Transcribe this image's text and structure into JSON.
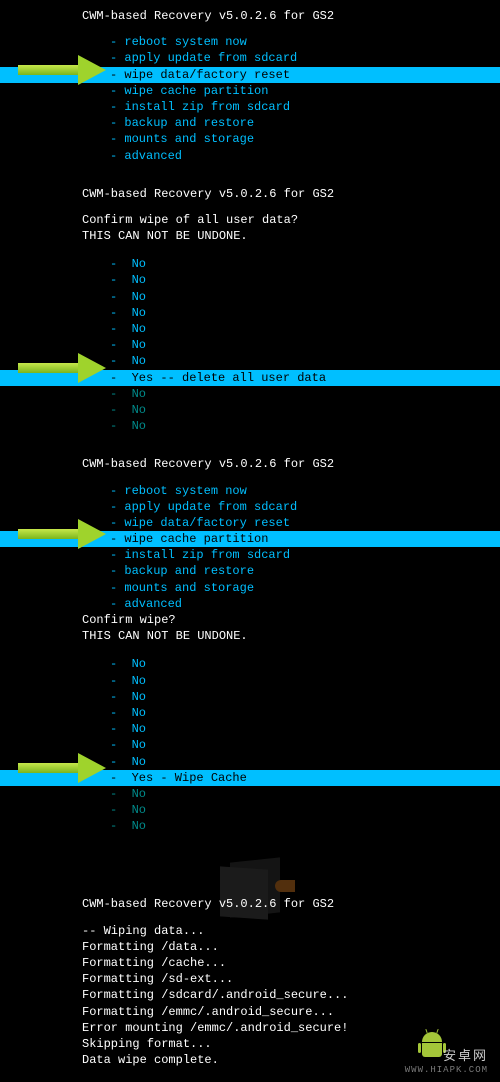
{
  "header": "CWM-based Recovery v5.0.2.6 for GS2",
  "panel1": {
    "items": [
      "- reboot system now",
      "- apply update from sdcard",
      "- wipe data/factory reset",
      "- wipe cache partition",
      "- install zip from sdcard",
      "- backup and restore",
      "- mounts and storage",
      "- advanced"
    ],
    "selected_index": 2
  },
  "panel2": {
    "prompt1": "Confirm wipe of all user data?",
    "prompt2": "  THIS CAN NOT BE UNDONE.",
    "items": [
      "-  No",
      "-  No",
      "-  No",
      "-  No",
      "-  No",
      "-  No",
      "-  No",
      "-  Yes -- delete all user data",
      "-  No",
      "-  No",
      "-  No"
    ],
    "selected_index": 7
  },
  "panel3": {
    "items": [
      "- reboot system now",
      "- apply update from sdcard",
      "- wipe data/factory reset",
      "- wipe cache partition",
      "- install zip from sdcard",
      "- backup and restore",
      "- mounts and storage",
      "- advanced"
    ],
    "selected_index": 3,
    "prompt1": "Confirm wipe?",
    "prompt2": "  THIS CAN NOT BE UNDONE.",
    "confirm_items": [
      "-  No",
      "-  No",
      "-  No",
      "-  No",
      "-  No",
      "-  No",
      "-  No",
      "-  Yes - Wipe Cache",
      "-  No",
      "-  No",
      "-  No"
    ],
    "confirm_selected_index": 7
  },
  "panel4": {
    "log": [
      "-- Wiping data...",
      "Formatting /data...",
      "Formatting /cache...",
      "Formatting /sd-ext...",
      "Formatting /sdcard/.android_secure...",
      "Formatting /emmc/.android_secure...",
      "Error mounting /emmc/.android_secure!",
      "Skipping format...",
      "Data wipe complete."
    ]
  },
  "watermark": {
    "line1": "安卓网",
    "line2": "WWW.HIAPK.COM"
  }
}
